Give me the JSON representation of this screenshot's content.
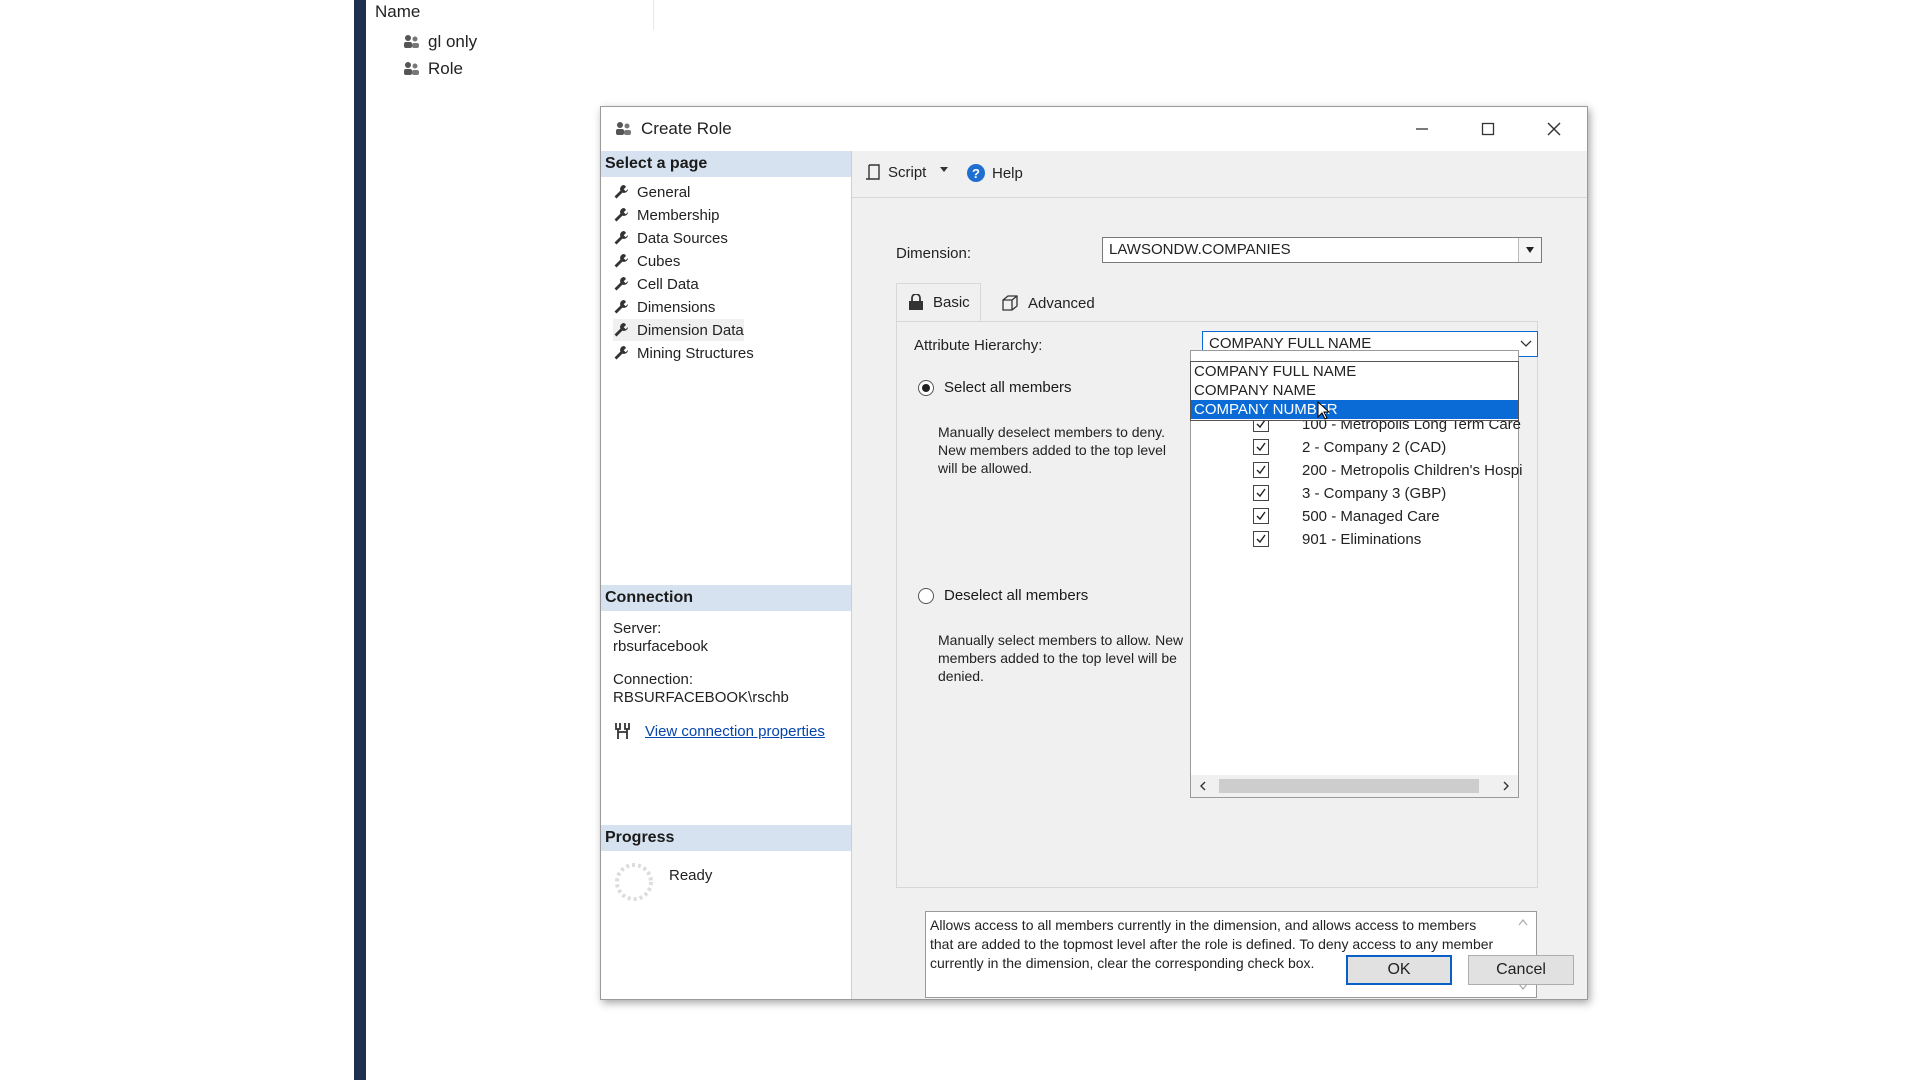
{
  "background": {
    "column_header": "Name",
    "items": [
      {
        "label": "gl only",
        "icon": "role-icon"
      },
      {
        "label": "Role",
        "icon": "role-icon"
      }
    ]
  },
  "dialog": {
    "title": "Create Role",
    "select_page_header": "Select a page",
    "pages": [
      "General",
      "Membership",
      "Data Sources",
      "Cubes",
      "Cell Data",
      "Dimensions",
      "Dimension Data",
      "Mining Structures"
    ],
    "selected_page": "Dimension Data",
    "connection": {
      "header": "Connection",
      "server_label": "Server:",
      "server_value": "rbsurfacebook",
      "connection_label": "Connection:",
      "connection_value": "RBSURFACEBOOK\\rschb",
      "link": "View connection properties"
    },
    "progress": {
      "header": "Progress",
      "status": "Ready"
    },
    "toolbar": {
      "script": "Script",
      "help": "Help"
    },
    "dimension_label": "Dimension:",
    "dimension_value": "LAWSONDW.COMPANIES",
    "tabs": {
      "basic": "Basic",
      "advanced": "Advanced"
    },
    "attribute_label": "Attribute Hierarchy:",
    "attribute_value": "COMPANY FULL NAME",
    "dropdown_options": [
      "COMPANY FULL NAME",
      "COMPANY NAME",
      "COMPANY NUMBER"
    ],
    "dropdown_selected": "COMPANY NUMBER",
    "select_all": {
      "label": "Select all members",
      "description": "Manually deselect members to deny. New members added to the top level will be allowed.",
      "checked": true
    },
    "deselect_all": {
      "label": "Deselect all members",
      "description": "Manually select members to allow. New members added to the top level will be denied.",
      "checked": false
    },
    "members": [
      "100 - Metropolis Long Term Care",
      "2 - Company 2 (CAD)",
      "200 - Metropolis Children's Hospi",
      "3 - Company 3 (GBP)",
      "500 - Managed Care",
      "901 - Eliminations"
    ],
    "info_text": "Allows access to all members currently in the dimension, and allows access to members that are added to the topmost level after the role is defined. To deny access to any member currently in the dimension, clear the corresponding check box.",
    "buttons": {
      "ok": "OK",
      "cancel": "Cancel"
    }
  }
}
